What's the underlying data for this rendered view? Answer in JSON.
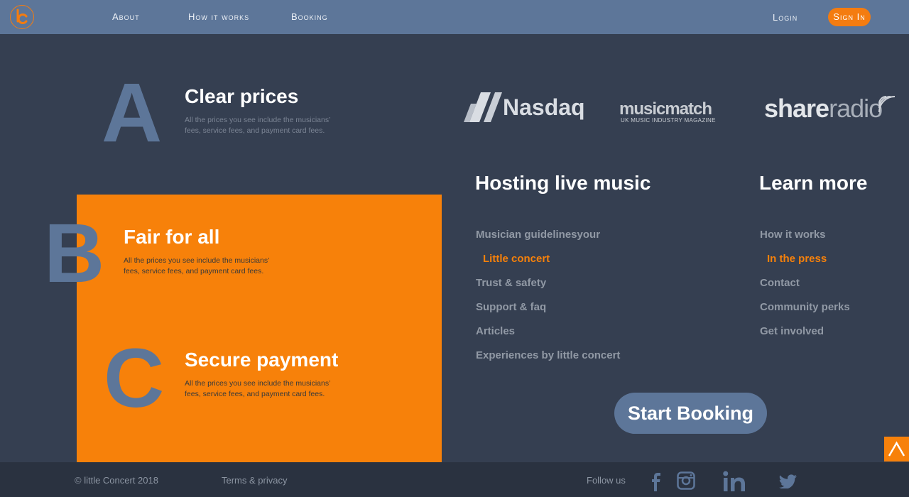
{
  "header": {
    "nav": [
      "About",
      "How it works",
      "Booking"
    ],
    "login": "Login",
    "signin": "Sign In"
  },
  "features": [
    {
      "letter": "A",
      "title": "Clear prices",
      "desc": "All the prices you see include the musicians’ fees, service fees, and payment card fees."
    },
    {
      "letter": "B",
      "title": "Fair for all",
      "desc": "All the prices you see include the musicians’ fees, service fees, and payment card fees."
    },
    {
      "letter": "C",
      "title": "Secure payment",
      "desc": "All the prices you see include the musicians’ fees, service fees, and payment card fees."
    }
  ],
  "press": {
    "nasdaq": "Nasdaq",
    "musicmatch": "musicmatch",
    "musicmatch_sub": "UK MUSIC INDUSTRY MAGAZINE",
    "shareradio_a": "share",
    "shareradio_b": "radio"
  },
  "hosting": {
    "title": "Hosting live music",
    "links": [
      "Musician guidelinesyour",
      "Little concert",
      "Trust & safety",
      "Support & faq",
      "Articles",
      "Experiences by little concert"
    ]
  },
  "learn": {
    "title": "Learn more",
    "links": [
      "How it works",
      "In the press",
      "Contact",
      "Community perks",
      "Get involved"
    ]
  },
  "cta": "Start Booking",
  "footer": {
    "copyright": "© little Concert 2018",
    "terms": "Terms & privacy",
    "follow": "Follow us"
  },
  "colors": {
    "header": "#5d7699",
    "background": "#353f51",
    "accent": "#f7810a",
    "footer": "#2a3240"
  },
  "icons": [
    "logo-icon",
    "facebook-icon",
    "instagram-icon",
    "linkedin-icon",
    "twitter-icon",
    "chevron-up-icon"
  ]
}
